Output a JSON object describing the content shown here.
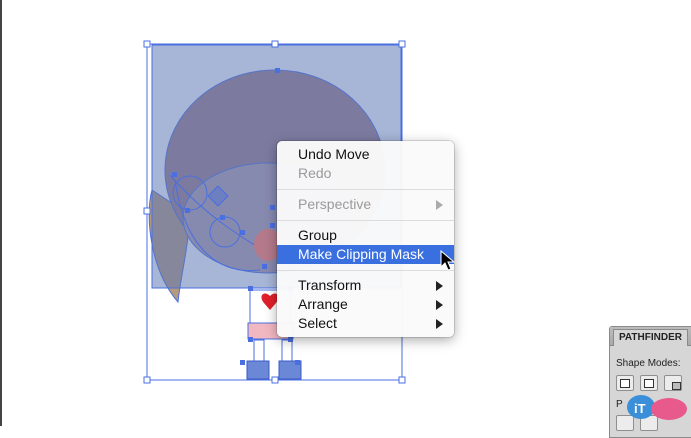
{
  "context_menu": {
    "items": {
      "undo_move": "Undo Move",
      "redo": "Redo",
      "perspective": "Perspective",
      "group": "Group",
      "make_clipping_mask": "Make Clipping Mask",
      "transform": "Transform",
      "arrange": "Arrange",
      "select": "Select"
    },
    "highlight_color": "#3a6fe0"
  },
  "pathfinder_panel": {
    "tab_title": "PATHFINDER",
    "shape_modes_label": "Shape Modes:",
    "pathfinders_label_fragment": "P"
  },
  "selection": {
    "fill_color": "#7a8fbf",
    "handle_color": "#4a6fe0"
  },
  "watermark": {
    "text": "iT邦幫忙"
  },
  "icons": [
    "submenu-arrow-icon",
    "mouse-pointer-icon",
    "shape-mode-icon"
  ]
}
